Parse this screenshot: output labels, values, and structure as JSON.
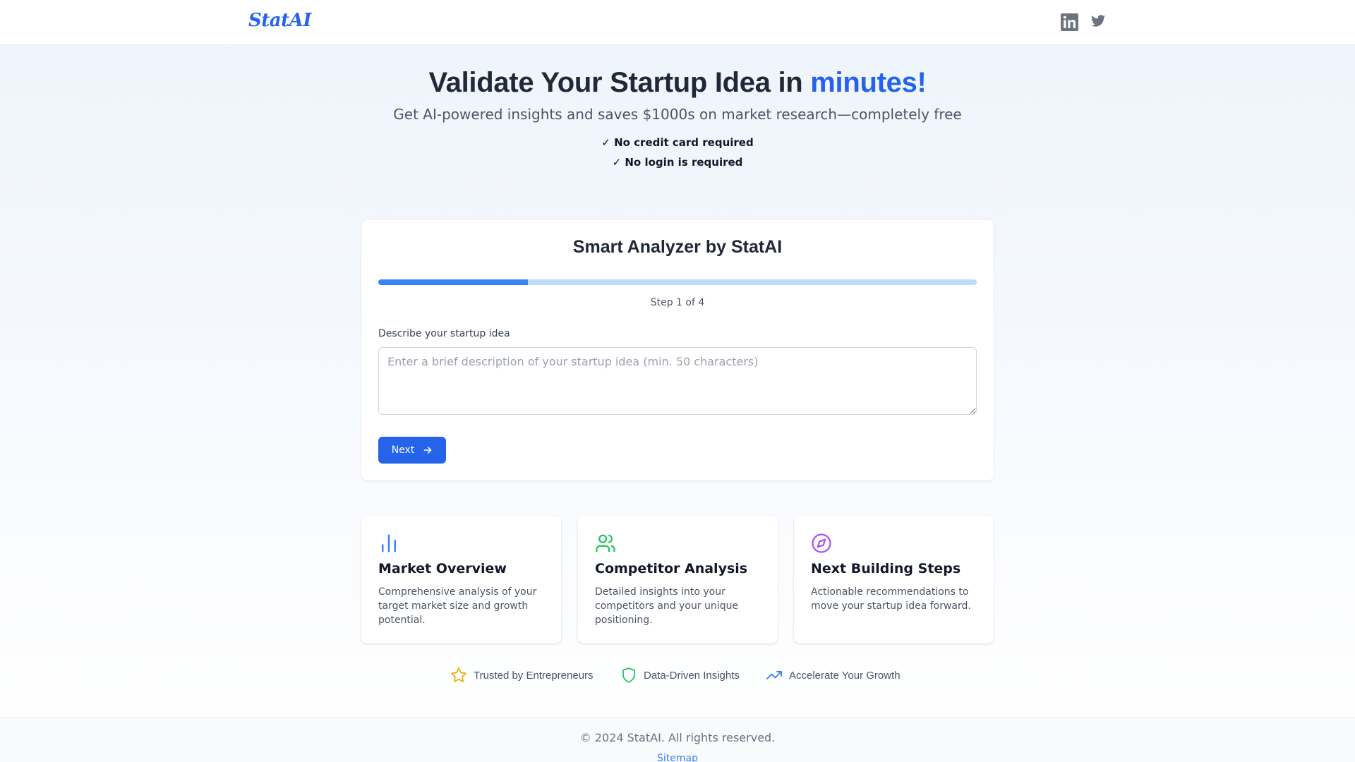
{
  "header": {
    "logo": "StatAI",
    "social": [
      {
        "icon": "linkedin-icon"
      },
      {
        "icon": "twitter-icon"
      }
    ]
  },
  "hero": {
    "title_main": "Validate Your Startup Idea in ",
    "title_accent": "minutes!",
    "subtitle": "Get AI-powered insights and saves $1000s on market research—completely free",
    "checks": [
      "✓ No credit card required",
      "✓ No login is required"
    ]
  },
  "analyzer": {
    "title": "Smart Analyzer by StatAI",
    "progress_fraction": 0.25,
    "step_text": "Step 1 of 4",
    "field_label": "Describe your startup idea",
    "input_value": "",
    "input_placeholder": "Enter a brief description of your startup idea (min. 50 characters)",
    "next_label": "Next"
  },
  "features": [
    {
      "icon": "bar-chart-icon",
      "title": "Market Overview",
      "description": "Comprehensive analysis of your target market size and growth potential."
    },
    {
      "icon": "users-icon",
      "title": "Competitor Analysis",
      "description": "Detailed insights into your competitors and your unique positioning."
    },
    {
      "icon": "compass-icon",
      "title": "Next Building Steps",
      "description": "Actionable recommendations to move your startup idea forward."
    }
  ],
  "trust": [
    {
      "icon": "star-icon",
      "label": "Trusted by Entrepreneurs"
    },
    {
      "icon": "shield-icon",
      "label": "Data-Driven Insights"
    },
    {
      "icon": "trending-up-icon",
      "label": "Accelerate Your Growth"
    }
  ],
  "footer": {
    "copyright": "© 2024 StatAI. All rights reserved.",
    "sitemap": "Sitemap"
  },
  "colors": {
    "accent": "#2563eb",
    "progress_track": "#bfdbfe",
    "progress_fill": "#3b82f6",
    "market_icon": "#3b82f6",
    "competitor_icon": "#22c55e",
    "steps_icon": "#a855f7",
    "star_icon": "#eab308",
    "shield_icon": "#22c55e",
    "trend_icon": "#3b82f6"
  }
}
